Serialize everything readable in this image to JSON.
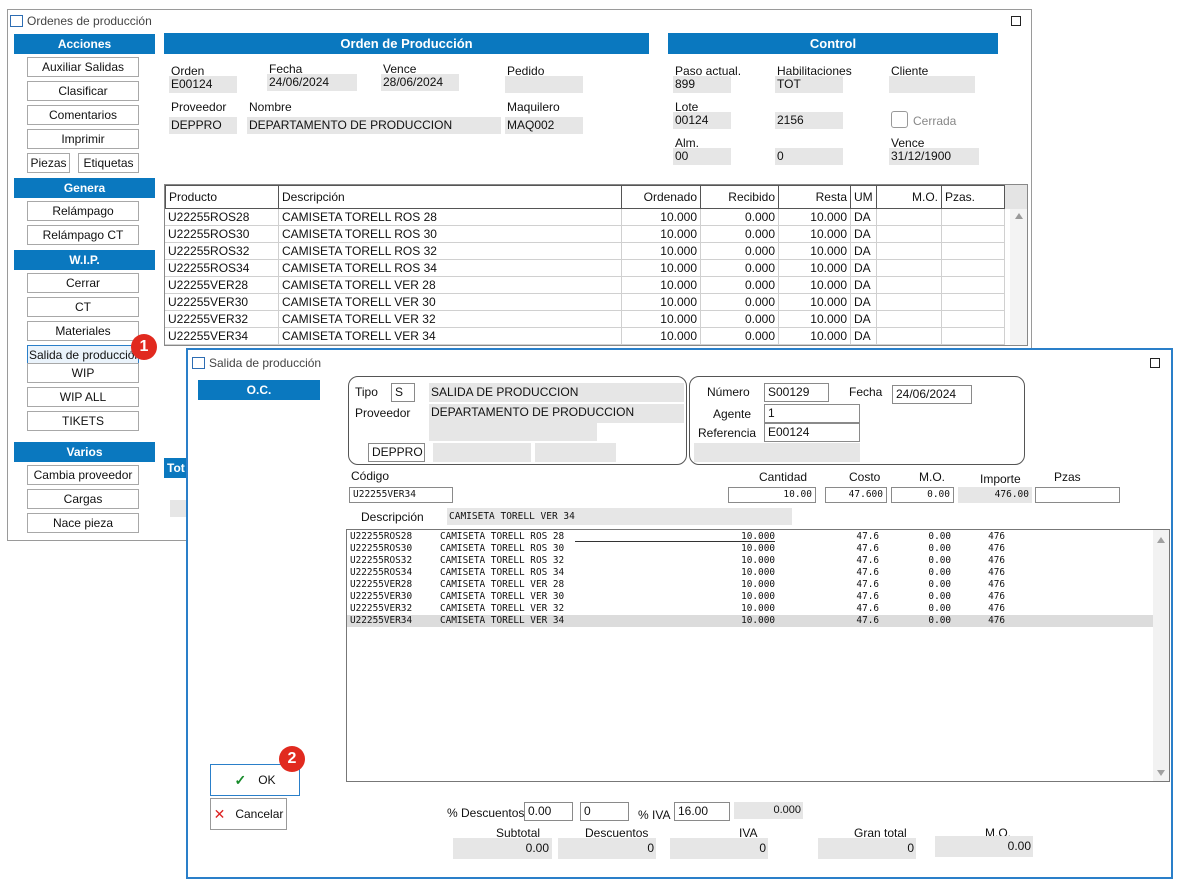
{
  "back": {
    "title": "Ordenes de producción",
    "sidebar": {
      "sec_acciones": "Acciones",
      "sec_genera": "Genera",
      "sec_wip": "W.I.P.",
      "sec_varios": "Varios",
      "auxiliar": "Auxiliar Salidas",
      "clasificar": "Clasificar",
      "comentarios": "Comentarios",
      "imprimir": "Imprimir",
      "piezas": "Piezas",
      "etiquetas": "Etiquetas",
      "relampago": "Relámpago",
      "relampago_ct": "Relámpago CT",
      "cerrar": "Cerrar",
      "ct": "CT",
      "materiales": "Materiales",
      "salida": "Salida de producción",
      "wip": "WIP",
      "wip_all": "WIP ALL",
      "tikets": "TIKETS",
      "cambia": "Cambia proveedor",
      "cargas": "Cargas",
      "nace": "Nace pieza"
    },
    "order": {
      "header": "Orden de Producción",
      "orden_label": "Orden",
      "orden": "E00124",
      "fecha_label": "Fecha",
      "fecha": "24/06/2024",
      "vence_label": "Vence",
      "vence": "28/06/2024",
      "pedido_label": "Pedido",
      "pedido": "",
      "proveedor_label": "Proveedor",
      "proveedor": "DEPPRO",
      "nombre_label": "Nombre",
      "nombre": "DEPARTAMENTO  DE PRODUCCION",
      "maquilero_label": "Maquilero",
      "maquilero": "MAQ002"
    },
    "control": {
      "header": "Control",
      "paso_label": "Paso actual.",
      "paso": "899",
      "habil_label": "Habilitaciones",
      "habil": "TOT",
      "cliente_label": "Cliente",
      "cliente": "",
      "lote_label": "Lote",
      "lote": "00124",
      "lote2": "2156",
      "cerrada_label": "Cerrada",
      "alm_label": "Alm.",
      "alm": "00",
      "alm2": "0",
      "vence_label": "Vence",
      "vence": "31/12/1900"
    },
    "table": {
      "headers": {
        "producto": "Producto",
        "descripcion": "Descripción",
        "ordenado": "Ordenado",
        "recibido": "Recibido",
        "resta": "Resta",
        "um": "UM",
        "mo": "M.O.",
        "pzas": "Pzas."
      },
      "rows": [
        {
          "producto": "U22255ROS28",
          "descripcion": "CAMISETA TORELL ROS 28",
          "ordenado": "10.000",
          "recibido": "0.000",
          "resta": "10.000",
          "um": "DA"
        },
        {
          "producto": "U22255ROS30",
          "descripcion": "CAMISETA TORELL ROS 30",
          "ordenado": "10.000",
          "recibido": "0.000",
          "resta": "10.000",
          "um": "DA"
        },
        {
          "producto": "U22255ROS32",
          "descripcion": "CAMISETA TORELL ROS 32",
          "ordenado": "10.000",
          "recibido": "0.000",
          "resta": "10.000",
          "um": "DA"
        },
        {
          "producto": "U22255ROS34",
          "descripcion": "CAMISETA TORELL ROS 34",
          "ordenado": "10.000",
          "recibido": "0.000",
          "resta": "10.000",
          "um": "DA"
        },
        {
          "producto": "U22255VER28",
          "descripcion": "CAMISETA TORELL VER 28",
          "ordenado": "10.000",
          "recibido": "0.000",
          "resta": "10.000",
          "um": "DA"
        },
        {
          "producto": "U22255VER30",
          "descripcion": "CAMISETA TORELL VER 30",
          "ordenado": "10.000",
          "recibido": "0.000",
          "resta": "10.000",
          "um": "DA"
        },
        {
          "producto": "U22255VER32",
          "descripcion": "CAMISETA TORELL VER 32",
          "ordenado": "10.000",
          "recibido": "0.000",
          "resta": "10.000",
          "um": "DA"
        },
        {
          "producto": "U22255VER34",
          "descripcion": "CAMISETA TORELL VER 34",
          "ordenado": "10.000",
          "recibido": "0.000",
          "resta": "10.000",
          "um": "DA"
        }
      ]
    },
    "tot_label": "Tot"
  },
  "badges": {
    "one": "1",
    "two": "2"
  },
  "dialog": {
    "title": "Salida de producción",
    "oc_header": "O.C.",
    "tipo_label": "Tipo",
    "tipo": "S",
    "tipo_desc": "SALIDA DE PRODUCCION",
    "proveedor_label": "Proveedor",
    "proveedor_name": "DEPARTAMENTO  DE PRODUCCION",
    "proveedor_code": "DEPPRO",
    "numero_label": "Número",
    "numero": "S00129",
    "fecha_label": "Fecha",
    "fecha": "24/06/2024",
    "agente_label": "Agente",
    "agente": "1",
    "referencia_label": "Referencia",
    "referencia": "E00124",
    "codigo_label": "Código",
    "codigo": "U22255VER34",
    "cantidad_label": "Cantidad",
    "cantidad": "10.00",
    "costo_label": "Costo",
    "costo": "47.600",
    "mo_label": "M.O.",
    "mo": "0.00",
    "importe_label": "Importe",
    "importe": "476.00",
    "pzas_label": "Pzas",
    "pzas": "",
    "descripcion_label": "Descripción",
    "descripcion": "CAMISETA TORELL VER 34",
    "list": [
      {
        "codigo": "U22255ROS28",
        "desc": "CAMISETA TORELL ROS 28",
        "cant": "10.000",
        "costo": "47.6",
        "mo": "0.00",
        "imp": "476"
      },
      {
        "codigo": "U22255ROS30",
        "desc": "CAMISETA TORELL ROS 30",
        "cant": "10.000",
        "costo": "47.6",
        "mo": "0.00",
        "imp": "476"
      },
      {
        "codigo": "U22255ROS32",
        "desc": "CAMISETA TORELL ROS 32",
        "cant": "10.000",
        "costo": "47.6",
        "mo": "0.00",
        "imp": "476"
      },
      {
        "codigo": "U22255ROS34",
        "desc": "CAMISETA TORELL ROS 34",
        "cant": "10.000",
        "costo": "47.6",
        "mo": "0.00",
        "imp": "476"
      },
      {
        "codigo": "U22255VER28",
        "desc": "CAMISETA TORELL VER 28",
        "cant": "10.000",
        "costo": "47.6",
        "mo": "0.00",
        "imp": "476"
      },
      {
        "codigo": "U22255VER30",
        "desc": "CAMISETA TORELL VER 30",
        "cant": "10.000",
        "costo": "47.6",
        "mo": "0.00",
        "imp": "476"
      },
      {
        "codigo": "U22255VER32",
        "desc": "CAMISETA TORELL VER 32",
        "cant": "10.000",
        "costo": "47.6",
        "mo": "0.00",
        "imp": "476"
      },
      {
        "codigo": "U22255VER34",
        "desc": "CAMISETA TORELL VER 34",
        "cant": "10.000",
        "costo": "47.6",
        "mo": "0.00",
        "imp": "476"
      }
    ],
    "selected_row": "U22255VER34",
    "ok": "OK",
    "cancelar": "Cancelar",
    "desc_label": "% Descuentos",
    "desc1": "0.00",
    "desc2": "0",
    "iva_label": "% IVA",
    "iva": "16.00",
    "iva_amt": "0.000",
    "subtotal_label": "Subtotal",
    "subtotal": "0.00",
    "descuentos_label": "Descuentos",
    "descuentos": "0",
    "iva_total_label": "IVA",
    "iva_total": "0",
    "gran_total_label": "Gran total",
    "gran_total": "0",
    "mo_total_label": "M.O.",
    "mo_total": "0.00"
  },
  "colors": {
    "accent": "#0a78bf",
    "badge": "#e12a1f",
    "dialog_border": "#2a7fc9",
    "field_gray": "#e6e6e6",
    "selected": "#dcdcdc"
  },
  "icons": {
    "check": "check-icon",
    "close": "close-icon"
  }
}
